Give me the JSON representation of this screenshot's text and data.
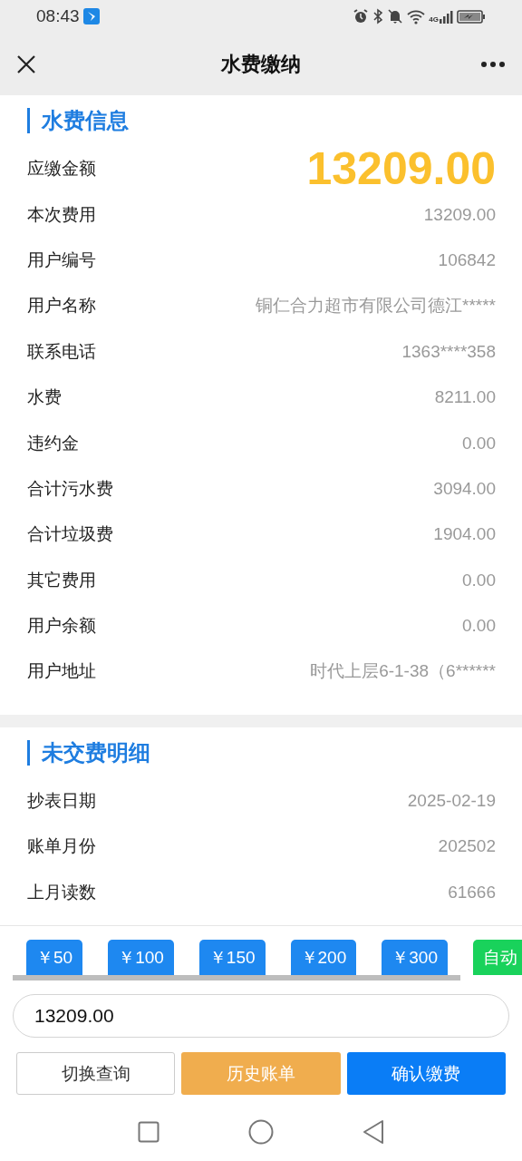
{
  "status_bar": {
    "time": "08:43",
    "network": "4G"
  },
  "header": {
    "title": "水费缴纳"
  },
  "sections": [
    {
      "title": "水费信息",
      "rows": [
        {
          "label": "应缴金额",
          "value": "13209.00",
          "kind": "highlight"
        },
        {
          "label": "本次费用",
          "value": "13209.00",
          "kind": "plain"
        },
        {
          "label": "用户编号",
          "value": "106842",
          "kind": "plain"
        },
        {
          "label": "用户名称",
          "value": "铜仁合力超市有限公司德江*****",
          "kind": "plain"
        },
        {
          "label": "联系电话",
          "value": "1363****358",
          "kind": "plain"
        },
        {
          "label": "水费",
          "value": "8211.00",
          "kind": "plain"
        },
        {
          "label": "违约金",
          "value": "0.00",
          "kind": "plain"
        },
        {
          "label": "合计污水费",
          "value": "3094.00",
          "kind": "plain"
        },
        {
          "label": "合计垃圾费",
          "value": "1904.00",
          "kind": "plain"
        },
        {
          "label": "其它费用",
          "value": "0.00",
          "kind": "plain"
        },
        {
          "label": "用户余额",
          "value": "0.00",
          "kind": "plain"
        },
        {
          "label": "用户地址",
          "value": "时代上层6-1-38（6******",
          "kind": "plain"
        }
      ]
    },
    {
      "title": "未交费明细",
      "rows": [
        {
          "label": "抄表日期",
          "value": "2025-02-19",
          "kind": "plain"
        },
        {
          "label": "账单月份",
          "value": "202502",
          "kind": "plain"
        },
        {
          "label": "上月读数",
          "value": "61666",
          "kind": "plain"
        }
      ]
    }
  ],
  "quick_amounts": [
    {
      "label": "￥50",
      "kind": "amount"
    },
    {
      "label": "￥100",
      "kind": "amount"
    },
    {
      "label": "￥150",
      "kind": "amount"
    },
    {
      "label": "￥200",
      "kind": "amount"
    },
    {
      "label": "￥300",
      "kind": "amount"
    },
    {
      "label": "自动",
      "kind": "auto"
    }
  ],
  "amount_input": {
    "value": "13209.00"
  },
  "buttons": [
    {
      "label": "切换查询",
      "kind": "outline"
    },
    {
      "label": "历史账单",
      "kind": "warning"
    },
    {
      "label": "确认缴费",
      "kind": "primary"
    }
  ]
}
